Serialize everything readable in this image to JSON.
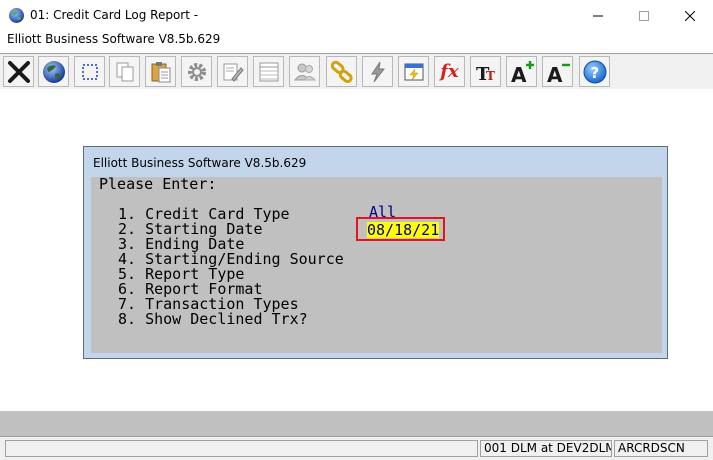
{
  "window": {
    "title": "01: Credit Card Log Report -",
    "subtitle": "Elliott Business Software V8.5b.629",
    "controls": {
      "minimize": "—",
      "maximize": "☐",
      "close": "✕"
    }
  },
  "toolbar": {
    "buttons": [
      {
        "name": "exit",
        "icon": "close-x-icon"
      },
      {
        "name": "globe",
        "icon": "globe-icon"
      },
      {
        "name": "select",
        "icon": "select-box-icon"
      },
      {
        "name": "copy",
        "icon": "copy-icon"
      },
      {
        "name": "paste",
        "icon": "paste-icon"
      },
      {
        "name": "settings",
        "icon": "gear-icon"
      },
      {
        "name": "edit",
        "icon": "edit-icon"
      },
      {
        "name": "list",
        "icon": "list-icon"
      },
      {
        "name": "users",
        "icon": "users-icon"
      },
      {
        "name": "link",
        "icon": "chain-link-icon"
      },
      {
        "name": "lightning",
        "icon": "lightning-icon"
      },
      {
        "name": "calendar",
        "icon": "calendar-icon"
      },
      {
        "name": "function",
        "icon": "function-icon",
        "text": "fx"
      },
      {
        "name": "text-size",
        "icon": "text-size-icon",
        "text": "TT"
      },
      {
        "name": "font-increase",
        "icon": "font-increase-icon",
        "text": "A"
      },
      {
        "name": "font-decrease",
        "icon": "font-decrease-icon",
        "text": "A"
      },
      {
        "name": "help",
        "icon": "help-icon",
        "text": "?"
      }
    ]
  },
  "dialog": {
    "title": "Elliott Business Software V8.5b.629",
    "prompt": "Please Enter:",
    "items": [
      "1. Credit Card Type",
      "2. Starting Date",
      "3. Ending Date",
      "4. Starting/Ending Source",
      "5. Report Type",
      "6. Report Format",
      "7. Transaction Types",
      "8. Show Declined Trx?"
    ],
    "credit_card_type_value": "All",
    "starting_date_value": "08/18/21"
  },
  "status_bar": {
    "panels": [
      "",
      "001 DLM at DEV2DLM",
      "ARCRDSCN"
    ]
  },
  "colors": {
    "highlight_border": "#e0161c",
    "input_bg": "#ffff00",
    "input_text": "#00008b",
    "dialog_frame": "#c3d5eb",
    "terminal_bg": "#c0c0c0"
  }
}
